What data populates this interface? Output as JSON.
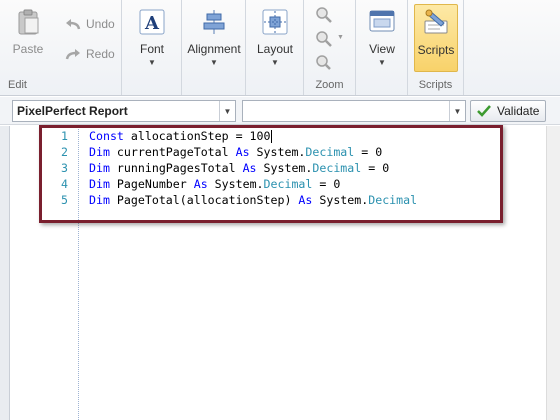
{
  "ribbon": {
    "edit_group": {
      "label": "Edit",
      "paste": "Paste",
      "undo": "Undo",
      "redo": "Redo"
    },
    "font": {
      "label": "Font"
    },
    "alignment": {
      "label": "Alignment"
    },
    "layout": {
      "label": "Layout"
    },
    "zoom_group": {
      "label": "Zoom"
    },
    "view": {
      "label": "View"
    },
    "scripts_group": {
      "label": "Scripts",
      "button": "Scripts"
    }
  },
  "toolbar": {
    "object_combo": "PixelPerfect   Report",
    "event_combo": "",
    "validate": "Validate"
  },
  "editor": {
    "lines": [
      {
        "num": "1",
        "tokens": [
          {
            "t": "Const",
            "c": "kw"
          },
          {
            "t": " allocationStep = 100",
            "c": "plain"
          }
        ]
      },
      {
        "num": "2",
        "tokens": [
          {
            "t": "Dim",
            "c": "kw"
          },
          {
            "t": " currentPageTotal ",
            "c": "plain"
          },
          {
            "t": "As",
            "c": "kw"
          },
          {
            "t": " System.",
            "c": "plain"
          },
          {
            "t": "Decimal",
            "c": "type"
          },
          {
            "t": " = 0",
            "c": "plain"
          }
        ]
      },
      {
        "num": "3",
        "tokens": [
          {
            "t": "Dim",
            "c": "kw"
          },
          {
            "t": " runningPagesTotal ",
            "c": "plain"
          },
          {
            "t": "As",
            "c": "kw"
          },
          {
            "t": " System.",
            "c": "plain"
          },
          {
            "t": "Decimal",
            "c": "type"
          },
          {
            "t": " = 0",
            "c": "plain"
          }
        ]
      },
      {
        "num": "4",
        "tokens": [
          {
            "t": "Dim",
            "c": "kw"
          },
          {
            "t": " PageNumber ",
            "c": "plain"
          },
          {
            "t": "As",
            "c": "kw"
          },
          {
            "t": " System.",
            "c": "plain"
          },
          {
            "t": "Decimal",
            "c": "type"
          },
          {
            "t": " = 0",
            "c": "plain"
          }
        ]
      },
      {
        "num": "5",
        "tokens": [
          {
            "t": "Dim",
            "c": "kw"
          },
          {
            "t": " PageTotal(allocationStep) ",
            "c": "plain"
          },
          {
            "t": "As",
            "c": "kw"
          },
          {
            "t": " System.",
            "c": "plain"
          },
          {
            "t": "Decimal",
            "c": "type"
          }
        ]
      }
    ]
  },
  "colors": {
    "keyword": "#0000ff",
    "type": "#2b91af",
    "highlight_border": "#7a1f2e",
    "scripts_active": "#f8d26a"
  }
}
